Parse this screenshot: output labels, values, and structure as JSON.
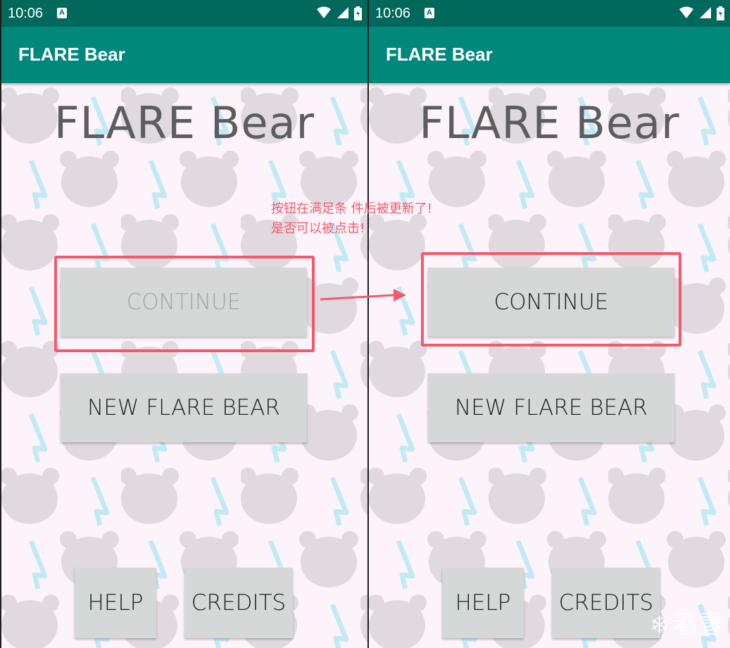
{
  "status_bar": {
    "time": "10:06",
    "notif_icon": "A"
  },
  "app_bar": {
    "title": "FLARE Bear"
  },
  "screen": {
    "logo_title": "FLARE Bear",
    "continue_label": "CONTINUE",
    "new_label": "NEW FLARE BEAR",
    "help_label": "HELP",
    "credits_label": "CREDITS"
  },
  "annotation": {
    "line1": "按钮在满足条 件后被更新了!",
    "line2": "是否可以被点击!"
  },
  "watermark": {
    "icon": "snowflake-icon",
    "text": "看雪"
  },
  "colors": {
    "status_bar": "#00695c",
    "app_bar": "#00897b",
    "background": "#fdf4fb",
    "button": "#d6d7d7",
    "highlight": "#f25a6b"
  },
  "states": {
    "left_continue": "disabled",
    "right_continue": "enabled"
  }
}
